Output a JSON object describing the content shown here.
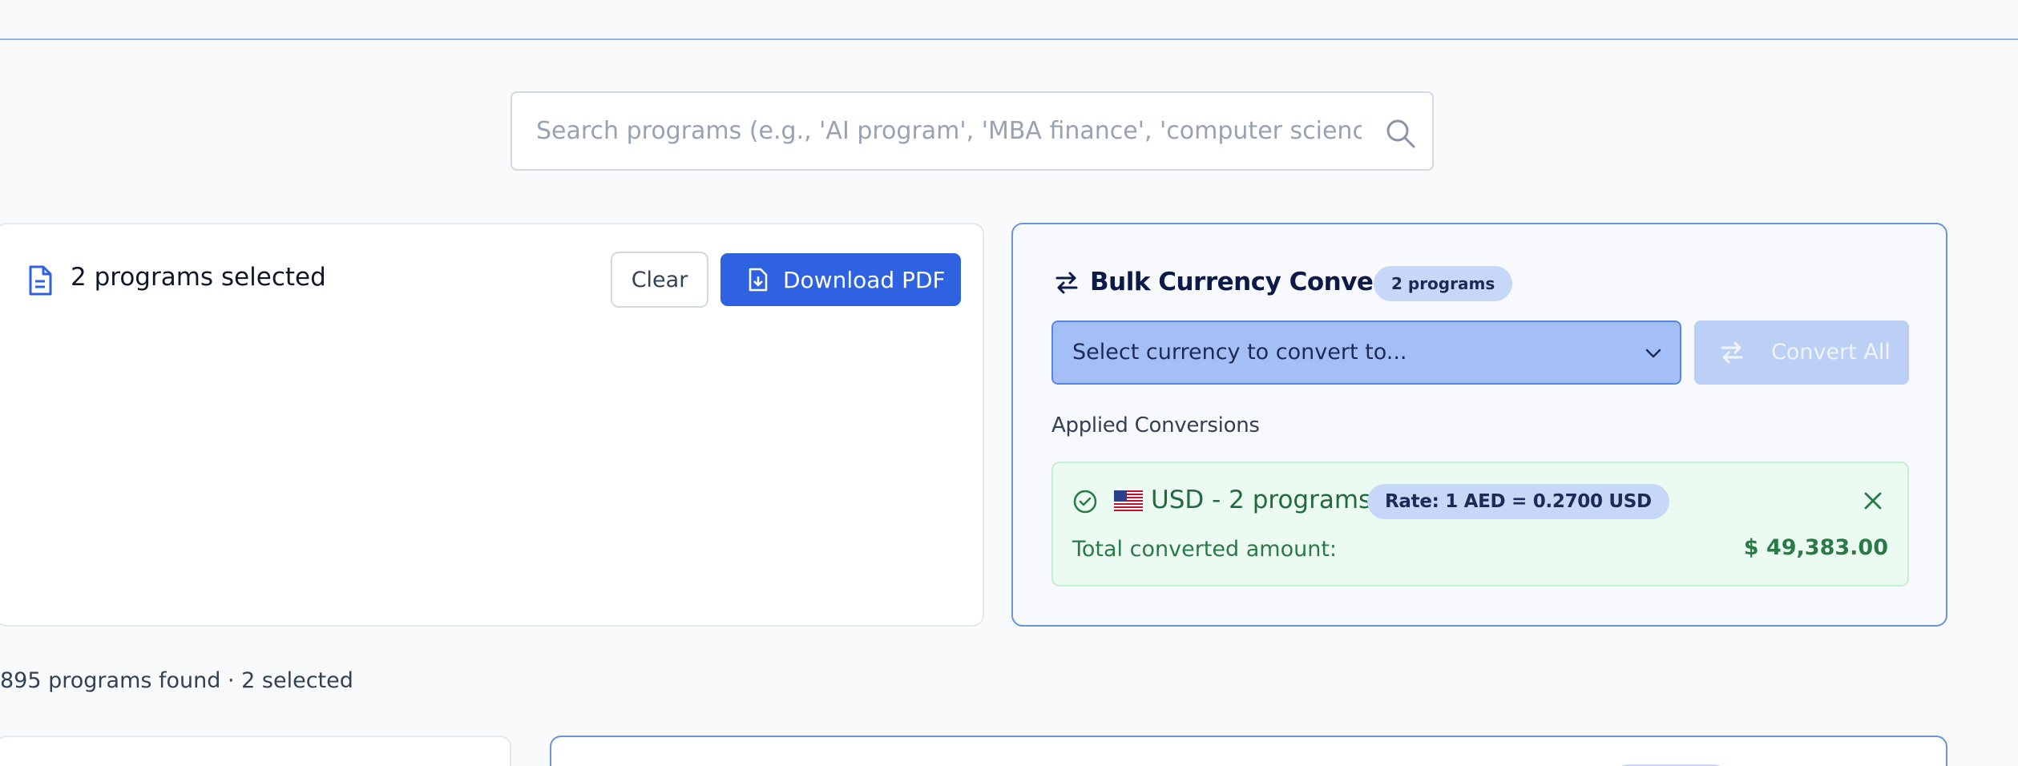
{
  "search": {
    "placeholder": "Search programs (e.g., 'AI program', 'MBA finance', 'computer science')",
    "icon": "search-icon"
  },
  "selection": {
    "title": "2 programs selected",
    "clear_label": "Clear",
    "download_label": "Download PDF",
    "icons": [
      "document-icon",
      "file-download-icon"
    ]
  },
  "converter": {
    "title": "Bulk Currency Converter",
    "badge": "2 programs",
    "select_placeholder": "Select currency to convert to...",
    "convert_all_label": "Convert All",
    "applied_heading": "Applied Conversions",
    "conversions": [
      {
        "flag": "🇺🇸",
        "label": "USD - 2 programs",
        "rate": "Rate: 1 AED = 0.2700 USD",
        "total_label": "Total converted amount:",
        "total_amount": "$ 49,383.00"
      }
    ]
  },
  "results": {
    "summary": "895 programs found · 2 selected"
  },
  "colors": {
    "accent": "#2f62e0",
    "accent_light": "#a4bff6",
    "badge": "#c6d7f8",
    "success_bg": "#ecfbf1",
    "success_text": "#2a7a48",
    "page_bg": "#f8fafc"
  }
}
